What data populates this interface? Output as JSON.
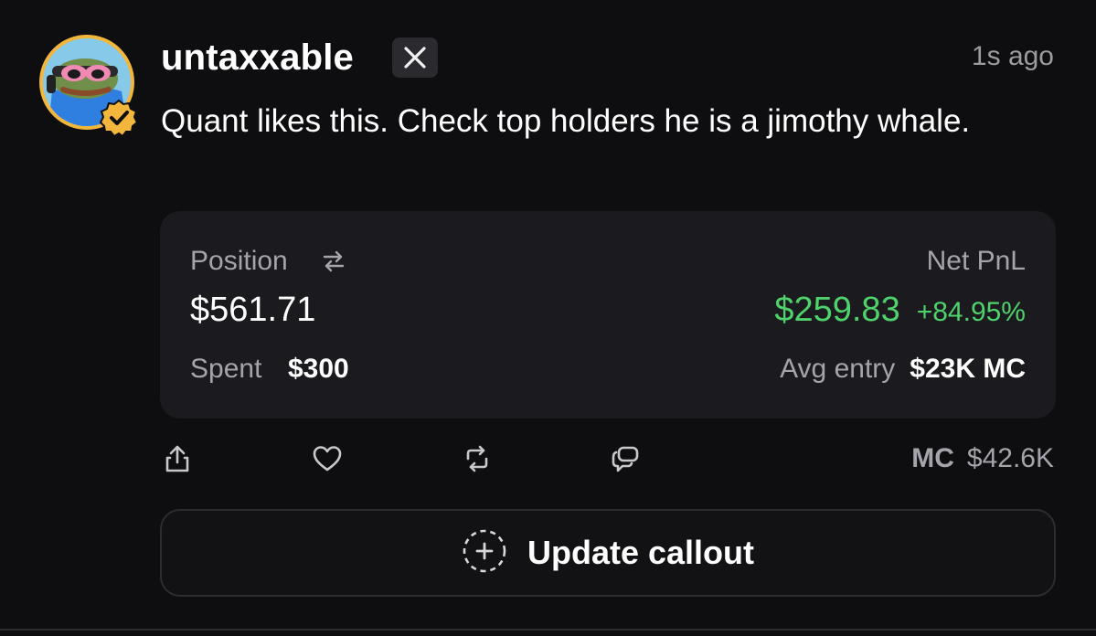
{
  "post": {
    "username": "untaxxable",
    "platform_badge": "x-logo-icon",
    "timestamp": "1s ago",
    "text": "Quant likes this. Check top holders he is a jimothy whale."
  },
  "position_card": {
    "position_label": "Position",
    "position_value": "$561.71",
    "spent_label": "Spent",
    "spent_value": "$300",
    "net_pnl_label": "Net PnL",
    "net_pnl_value": "$259.83",
    "net_pnl_percent": "+84.95%",
    "avg_entry_label": "Avg entry",
    "avg_entry_value": "$23K MC"
  },
  "actions": {
    "icons": [
      "share-icon",
      "heart-icon",
      "repost-icon",
      "comment-icon"
    ],
    "mc_label": "MC",
    "mc_value": "$42.6K"
  },
  "update_button": {
    "label": "Update callout",
    "icon": "dashed-plus-circle-icon"
  },
  "colors": {
    "background": "#0e0e10",
    "card": "#1b1b1f",
    "profit_green": "#4fd16b",
    "verified_gold": "#f2b63c",
    "muted_text": "#a4a4aa"
  }
}
